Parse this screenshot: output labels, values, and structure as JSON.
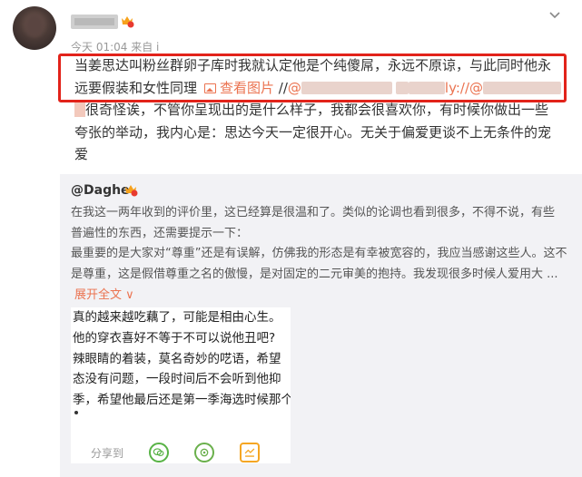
{
  "post": {
    "meta": "今天 01:04 来自 i",
    "body_lines": [
      "当姜思达叫粉丝群卵子库时我就认定他是个纯傻屌，永远不原谅，与此同时他永",
      "远要假装和女性同理",
      "很奇怪诶，不管你呈现出的是什么样子，我都会很喜欢你，有时候你做出一些",
      "夸张的举动，我内心是：思达今天一定很开心。无关于偏爱更谈不上无条件的宠",
      "爱"
    ],
    "view_image_label": "查看图片",
    "repost_separator_1": "//@",
    "repost_separator_2": "ly://@"
  },
  "repost": {
    "username": "@Daghe",
    "lines": [
      "在我这一两年收到的评价里，这已经算是很温和了。类似的论调也看到很多，不得不说，有些",
      "普遍性的东西，还需要提示一下：",
      "最重要的是大家对“尊重”还是有误解，仿佛我的形态是有幸被宽容的，我应当感谢这些人。这不",
      "是尊重，这是假借尊重之名的傲慢，是对固定的二元审美的抱持。我发现很多时候人爱用大 ..."
    ],
    "expand_label": "展开全文 ∨",
    "image_text_lines": [
      "真的越来越吃藕了，可能是相由心生。",
      "他的穿衣喜好不等于不可以说他丑吧?",
      "辣眼睛的着装，莫名奇妙的呓语，希望",
      "态没有问题，一段时间后不会听到他抑",
      "季，希望他最后还是第一季海选时候那个"
    ],
    "share_label": "分享到"
  },
  "colors": {
    "accent": "#eb7350",
    "highlight_box": "#e2231a",
    "repost_bg": "#f2f2f5"
  },
  "icons": [
    "avatar",
    "vip-badge-icon",
    "chevron-down-icon",
    "image-icon",
    "wechat-icon",
    "moments-icon",
    "qzone-icon"
  ]
}
